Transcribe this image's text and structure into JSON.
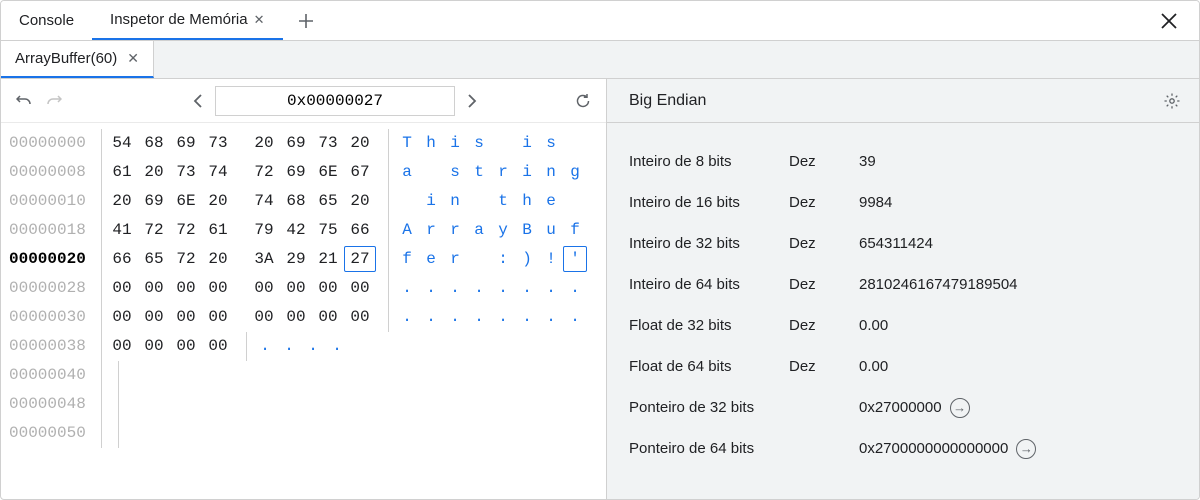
{
  "toolbar": {
    "tabs": [
      {
        "label": "Console",
        "active": false,
        "closable": false
      },
      {
        "label": "Inspetor de Memória",
        "active": true,
        "closable": true
      }
    ]
  },
  "subtab": {
    "label": "ArrayBuffer(60)"
  },
  "addressBar": {
    "value": "0x00000027"
  },
  "hex": {
    "selected_offset": "00000020",
    "selected_col": 7,
    "rows": [
      {
        "offset": "00000000",
        "bytes": [
          "54",
          "68",
          "69",
          "73",
          "20",
          "69",
          "73",
          "20"
        ],
        "ascii": [
          "T",
          "h",
          "i",
          "s",
          " ",
          "i",
          "s",
          " "
        ]
      },
      {
        "offset": "00000008",
        "bytes": [
          "61",
          "20",
          "73",
          "74",
          "72",
          "69",
          "6E",
          "67"
        ],
        "ascii": [
          "a",
          " ",
          "s",
          "t",
          "r",
          "i",
          "n",
          "g"
        ]
      },
      {
        "offset": "00000010",
        "bytes": [
          "20",
          "69",
          "6E",
          "20",
          "74",
          "68",
          "65",
          "20"
        ],
        "ascii": [
          " ",
          "i",
          "n",
          " ",
          "t",
          "h",
          "e",
          " "
        ]
      },
      {
        "offset": "00000018",
        "bytes": [
          "41",
          "72",
          "72",
          "61",
          "79",
          "42",
          "75",
          "66"
        ],
        "ascii": [
          "A",
          "r",
          "r",
          "a",
          "y",
          "B",
          "u",
          "f"
        ]
      },
      {
        "offset": "00000020",
        "bytes": [
          "66",
          "65",
          "72",
          "20",
          "3A",
          "29",
          "21",
          "27"
        ],
        "ascii": [
          "f",
          "e",
          "r",
          " ",
          ":",
          ")",
          "!",
          "'"
        ]
      },
      {
        "offset": "00000028",
        "bytes": [
          "00",
          "00",
          "00",
          "00",
          "00",
          "00",
          "00",
          "00"
        ],
        "ascii": [
          ".",
          ".",
          ".",
          ".",
          ".",
          ".",
          ".",
          "."
        ]
      },
      {
        "offset": "00000030",
        "bytes": [
          "00",
          "00",
          "00",
          "00",
          "00",
          "00",
          "00",
          "00"
        ],
        "ascii": [
          ".",
          ".",
          ".",
          ".",
          ".",
          ".",
          ".",
          "."
        ]
      },
      {
        "offset": "00000038",
        "bytes": [
          "00",
          "00",
          "00",
          "00"
        ],
        "ascii": [
          ".",
          ".",
          ".",
          "."
        ]
      },
      {
        "offset": "00000040",
        "bytes": [],
        "ascii": []
      },
      {
        "offset": "00000048",
        "bytes": [],
        "ascii": []
      },
      {
        "offset": "00000050",
        "bytes": [],
        "ascii": []
      }
    ]
  },
  "interp": {
    "endianness": "Big Endian",
    "rows": [
      {
        "label": "Inteiro de 8 bits",
        "fmt": "Dez",
        "value": "39",
        "goto": false
      },
      {
        "label": "Inteiro de 16 bits",
        "fmt": "Dez",
        "value": "9984",
        "goto": false
      },
      {
        "label": "Inteiro de 32 bits",
        "fmt": "Dez",
        "value": "654311424",
        "goto": false
      },
      {
        "label": "Inteiro de 64 bits",
        "fmt": "Dez",
        "value": "2810246167479189504",
        "goto": false
      },
      {
        "label": "Float de 32 bits",
        "fmt": "Dez",
        "value": "0.00",
        "goto": false
      },
      {
        "label": "Float de 64 bits",
        "fmt": "Dez",
        "value": "0.00",
        "goto": false
      },
      {
        "label": "Ponteiro de 32 bits",
        "fmt": "",
        "value": "0x27000000",
        "goto": true
      },
      {
        "label": "Ponteiro de 64 bits",
        "fmt": "",
        "value": "0x2700000000000000",
        "goto": true
      }
    ]
  }
}
